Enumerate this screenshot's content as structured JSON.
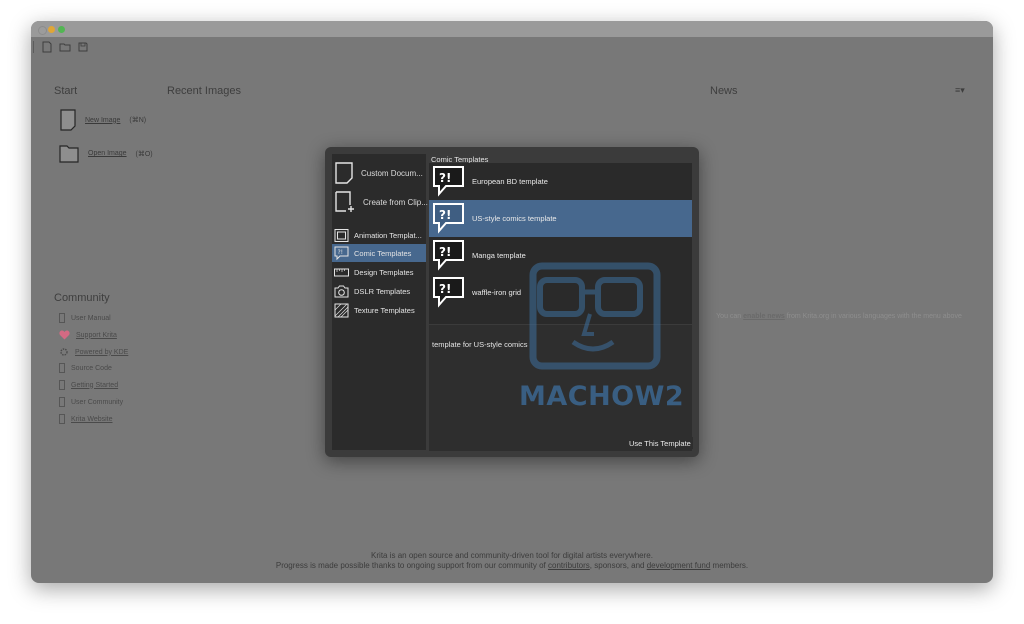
{
  "toolbar": {
    "icons": [
      "new-document-icon",
      "open-folder-icon",
      "save-icon"
    ]
  },
  "start": {
    "title": "Start",
    "items": [
      {
        "label": "New Image",
        "shortcut": "(⌘N)",
        "icon": "new-document-icon"
      },
      {
        "label": "Open Image",
        "shortcut": "(⌘O)",
        "icon": "folder-icon"
      }
    ]
  },
  "recent": {
    "title": "Recent Images"
  },
  "news": {
    "title": "News",
    "menu_icon": "≡▾",
    "text_before": "You can ",
    "text_link": "enable news",
    "text_after": " from Krita.org in various languages with the menu above"
  },
  "community": {
    "title": "Community",
    "items": [
      {
        "label": "User Manual",
        "icon": "bookmark-icon"
      },
      {
        "label": "Support Krita",
        "icon": "heart-icon"
      },
      {
        "label": "Powered by KDE",
        "icon": "kde-gear-icon"
      },
      {
        "label": "Source Code",
        "icon": "bookmark-icon"
      },
      {
        "label": "Getting Started",
        "icon": "bookmark-icon"
      },
      {
        "label": "User Community",
        "icon": "bookmark-icon"
      },
      {
        "label": "Krita Website",
        "icon": "bookmark-icon"
      }
    ]
  },
  "footer": {
    "line1": "Krita is an open source and community-driven tool for digital artists everywhere.",
    "line2_a": "Progress is made possible thanks to ongoing support from our community of ",
    "line2_link1": "contributors",
    "line2_b": ", sponsors, and ",
    "line2_link2": "development fund",
    "line2_c": " members."
  },
  "dialog": {
    "options": [
      {
        "label": "Custom Docum...",
        "icon": "custom-document-icon"
      },
      {
        "label": "Create from Clip...",
        "icon": "clipboard-new-icon"
      }
    ],
    "categories": [
      {
        "label": "Animation Templat...",
        "icon": "film-icon"
      },
      {
        "label": "Comic Templates",
        "icon": "comic-bubble-icon"
      },
      {
        "label": "Design Templates",
        "icon": "ruler-icon"
      },
      {
        "label": "DSLR Templates",
        "icon": "camera-icon"
      },
      {
        "label": "Texture Templates",
        "icon": "texture-icon"
      }
    ],
    "selected_category": "Comic Templates",
    "list_title": "Comic Templates",
    "templates": [
      {
        "label": "European BD template"
      },
      {
        "label": "US-style comics template"
      },
      {
        "label": "Manga template"
      },
      {
        "label": "waffle-iron grid"
      }
    ],
    "selected_template": "US-style comics template",
    "description": "template for US-style comics",
    "button": "Use This Template",
    "template_icon_text": "?!"
  },
  "watermark": {
    "text": "MACHOW2"
  },
  "colors": {
    "background": "#787878",
    "dialog": "#3b3b3b",
    "selection": "#47688e",
    "heart": "#d46a83",
    "watermark": "#3d6f9e"
  }
}
